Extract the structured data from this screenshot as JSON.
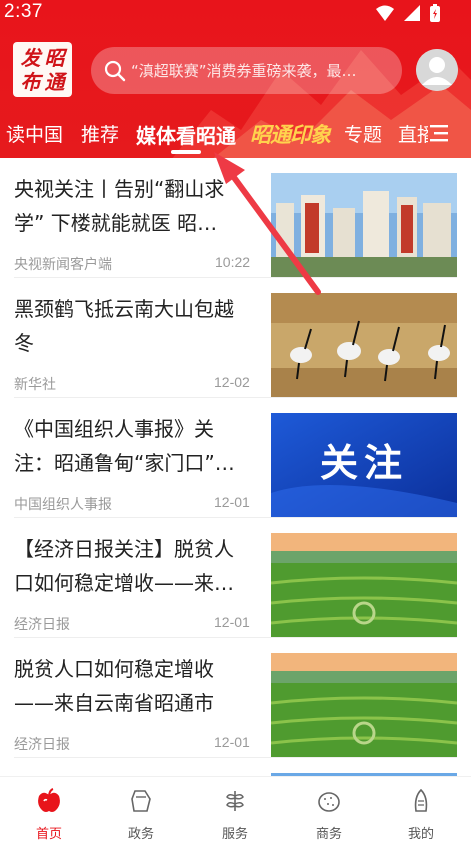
{
  "status_bar": {
    "time": "2:37"
  },
  "header": {
    "logo_chars": [
      "发",
      "昭",
      "布",
      "通"
    ],
    "search_placeholder": "“滇超联赛”消费券重磅来袭，最…",
    "accent_color": "#e8141b"
  },
  "tabs": {
    "items": [
      {
        "label": "读中国"
      },
      {
        "label": "推荐"
      },
      {
        "label": "媒体看昭通",
        "active": true
      },
      {
        "label": "昭通印象"
      },
      {
        "label": "专题"
      },
      {
        "label": "直播"
      }
    ]
  },
  "news": [
    {
      "title": "央视关注丨告别“翻山求学” 下楼就能就医 昭…",
      "source": "央视新闻客户端",
      "time": "10:22",
      "thumb": "buildings"
    },
    {
      "title": "黑颈鹤飞抵云南大山包越冬",
      "source": "新华社",
      "time": "12-02",
      "thumb": "cranes"
    },
    {
      "title": "《中国组织人事报》关注：昭通鲁甸“家门口”…",
      "source": "中国组织人事报",
      "time": "12-01",
      "thumb": "blue-banner",
      "thumb_text": "关注"
    },
    {
      "title": "【经济日报关注】脱贫人口如何稳定增收——来…",
      "source": "经济日报",
      "time": "12-01",
      "thumb": "farmland"
    },
    {
      "title": "脱贫人口如何稳定增收——来自云南省昭通市的…",
      "source": "经济日报",
      "time": "12-01",
      "thumb": "farmland"
    }
  ],
  "bottom_nav": {
    "items": [
      {
        "label": "首页",
        "icon": "home-apple-icon",
        "active": true
      },
      {
        "label": "政务",
        "icon": "government-icon"
      },
      {
        "label": "服务",
        "icon": "service-icon"
      },
      {
        "label": "商务",
        "icon": "business-icon"
      },
      {
        "label": "我的",
        "icon": "profile-icon"
      }
    ]
  }
}
